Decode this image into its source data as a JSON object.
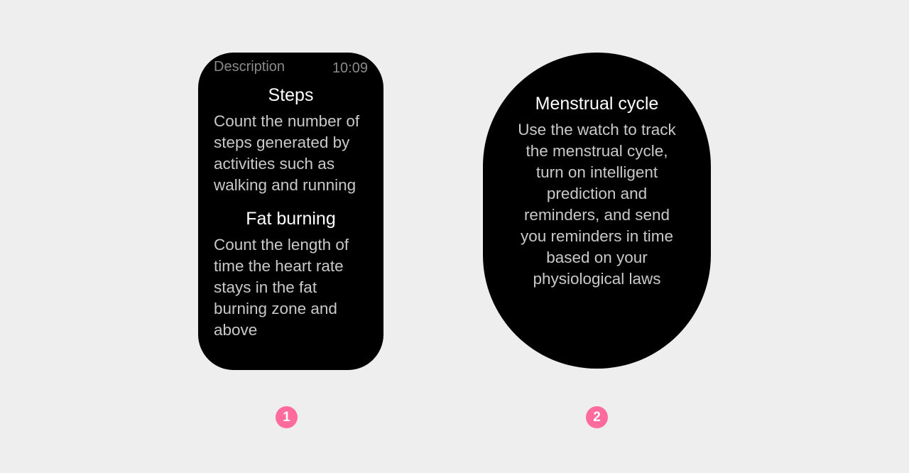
{
  "colors": {
    "background": "#eeeeee",
    "screen": "#000000",
    "heading": "#ffffff",
    "body_text": "#c9c9c9",
    "status_text": "#8a8a8a",
    "badge": "#ff6b9d"
  },
  "watch1": {
    "status_title": "Description",
    "time": "10:09",
    "sections": [
      {
        "heading": "Steps",
        "body": "Count the number of steps generated by activities such as walking and running"
      },
      {
        "heading": "Fat burning",
        "body": "Count the length of time the heart rate stays in the fat burning zone and above"
      }
    ],
    "badge": "1"
  },
  "watch2": {
    "heading": "Menstrual cycle",
    "body": "Use the watch to track the menstrual cycle, turn on intelligent prediction and reminders, and send you reminders in time based on your physiological laws",
    "badge": "2"
  }
}
